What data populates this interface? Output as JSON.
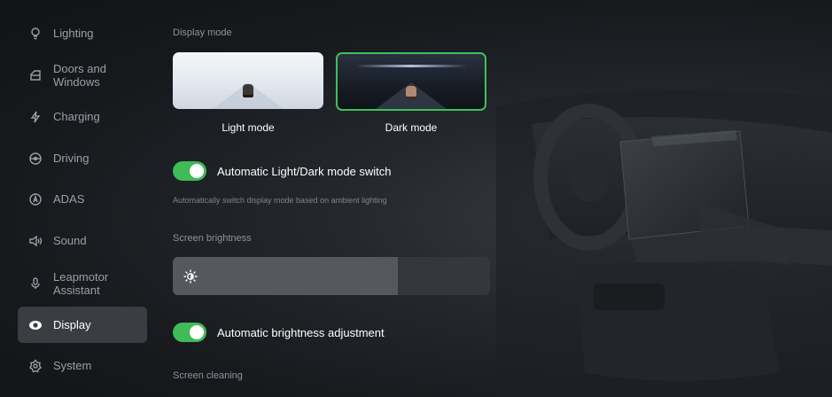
{
  "sidebar": {
    "items": [
      {
        "label": "Lighting",
        "icon": "bulb-icon"
      },
      {
        "label": "Doors and Windows",
        "icon": "door-icon"
      },
      {
        "label": "Charging",
        "icon": "charging-bolt-icon"
      },
      {
        "label": "Driving",
        "icon": "steering-wheel-icon"
      },
      {
        "label": "ADAS",
        "icon": "adas-icon"
      },
      {
        "label": "Sound",
        "icon": "speaker-icon"
      },
      {
        "label": "Leapmotor Assistant",
        "icon": "microphone-icon"
      },
      {
        "label": "Display",
        "icon": "eye-icon",
        "active": true
      },
      {
        "label": "System",
        "icon": "system-gear-icon"
      }
    ]
  },
  "display": {
    "display_mode_label": "Display mode",
    "light_mode_label": "Light mode",
    "dark_mode_label": "Dark mode",
    "selected_mode": "Dark mode",
    "auto_mode_switch_label": "Automatic Light/Dark mode switch",
    "auto_mode_switch_on": true,
    "auto_mode_hint": "Automatically switch display mode based on ambient lighting",
    "brightness_label": "Screen brightness",
    "brightness_fraction": 0.71,
    "auto_brightness_label": "Automatic brightness adjustment",
    "auto_brightness_on": true,
    "screen_cleaning_label": "Screen cleaning"
  },
  "colors": {
    "accent_green": "#3fbb58",
    "active_nav_bg": "#3a3d42"
  }
}
